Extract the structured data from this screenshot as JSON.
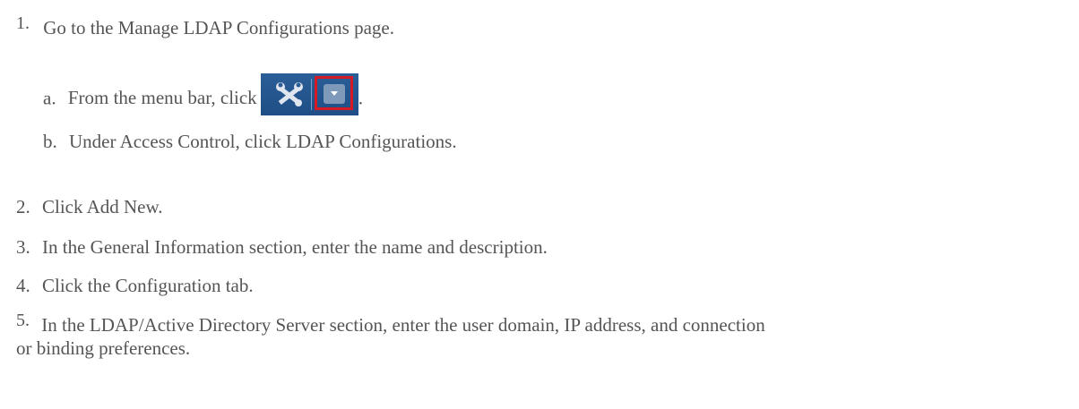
{
  "steps": [
    {
      "number": "1.",
      "text": "Go to the Manage LDAP Configurations page.",
      "substeps": [
        {
          "letter": "a.",
          "text_before": "From the menu bar, click",
          "text_after": "."
        },
        {
          "letter": "b.",
          "text": "Under Access Control, click LDAP Configurations."
        }
      ]
    },
    {
      "number": "2.",
      "text": "Click Add New."
    },
    {
      "number": "3.",
      "text": "In the General Information section, enter the name and description."
    },
    {
      "number": "4.",
      "text": "Click the Configuration tab."
    },
    {
      "number": "5.",
      "text_line1": "In the LDAP/Active Directory Server section, enter the user domain, IP address, and connection",
      "text_line2": "or binding preferences."
    }
  ],
  "icons": {
    "toolbar_button": "tools-icon",
    "dropdown": "chevron-down-icon",
    "highlight_color": "#d51a25",
    "button_color": "#2b5e97"
  }
}
